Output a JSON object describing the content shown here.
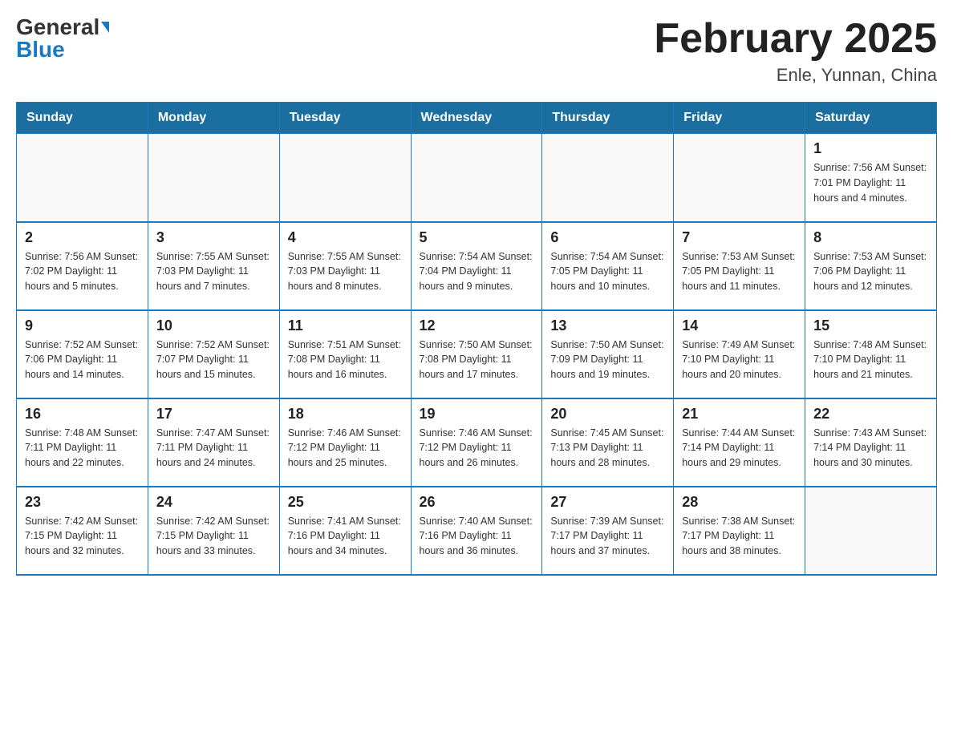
{
  "header": {
    "logo_general": "General",
    "logo_blue": "Blue",
    "month_title": "February 2025",
    "location": "Enle, Yunnan, China"
  },
  "weekdays": [
    "Sunday",
    "Monday",
    "Tuesday",
    "Wednesday",
    "Thursday",
    "Friday",
    "Saturday"
  ],
  "weeks": [
    [
      {
        "day": "",
        "info": ""
      },
      {
        "day": "",
        "info": ""
      },
      {
        "day": "",
        "info": ""
      },
      {
        "day": "",
        "info": ""
      },
      {
        "day": "",
        "info": ""
      },
      {
        "day": "",
        "info": ""
      },
      {
        "day": "1",
        "info": "Sunrise: 7:56 AM\nSunset: 7:01 PM\nDaylight: 11 hours\nand 4 minutes."
      }
    ],
    [
      {
        "day": "2",
        "info": "Sunrise: 7:56 AM\nSunset: 7:02 PM\nDaylight: 11 hours\nand 5 minutes."
      },
      {
        "day": "3",
        "info": "Sunrise: 7:55 AM\nSunset: 7:03 PM\nDaylight: 11 hours\nand 7 minutes."
      },
      {
        "day": "4",
        "info": "Sunrise: 7:55 AM\nSunset: 7:03 PM\nDaylight: 11 hours\nand 8 minutes."
      },
      {
        "day": "5",
        "info": "Sunrise: 7:54 AM\nSunset: 7:04 PM\nDaylight: 11 hours\nand 9 minutes."
      },
      {
        "day": "6",
        "info": "Sunrise: 7:54 AM\nSunset: 7:05 PM\nDaylight: 11 hours\nand 10 minutes."
      },
      {
        "day": "7",
        "info": "Sunrise: 7:53 AM\nSunset: 7:05 PM\nDaylight: 11 hours\nand 11 minutes."
      },
      {
        "day": "8",
        "info": "Sunrise: 7:53 AM\nSunset: 7:06 PM\nDaylight: 11 hours\nand 12 minutes."
      }
    ],
    [
      {
        "day": "9",
        "info": "Sunrise: 7:52 AM\nSunset: 7:06 PM\nDaylight: 11 hours\nand 14 minutes."
      },
      {
        "day": "10",
        "info": "Sunrise: 7:52 AM\nSunset: 7:07 PM\nDaylight: 11 hours\nand 15 minutes."
      },
      {
        "day": "11",
        "info": "Sunrise: 7:51 AM\nSunset: 7:08 PM\nDaylight: 11 hours\nand 16 minutes."
      },
      {
        "day": "12",
        "info": "Sunrise: 7:50 AM\nSunset: 7:08 PM\nDaylight: 11 hours\nand 17 minutes."
      },
      {
        "day": "13",
        "info": "Sunrise: 7:50 AM\nSunset: 7:09 PM\nDaylight: 11 hours\nand 19 minutes."
      },
      {
        "day": "14",
        "info": "Sunrise: 7:49 AM\nSunset: 7:10 PM\nDaylight: 11 hours\nand 20 minutes."
      },
      {
        "day": "15",
        "info": "Sunrise: 7:48 AM\nSunset: 7:10 PM\nDaylight: 11 hours\nand 21 minutes."
      }
    ],
    [
      {
        "day": "16",
        "info": "Sunrise: 7:48 AM\nSunset: 7:11 PM\nDaylight: 11 hours\nand 22 minutes."
      },
      {
        "day": "17",
        "info": "Sunrise: 7:47 AM\nSunset: 7:11 PM\nDaylight: 11 hours\nand 24 minutes."
      },
      {
        "day": "18",
        "info": "Sunrise: 7:46 AM\nSunset: 7:12 PM\nDaylight: 11 hours\nand 25 minutes."
      },
      {
        "day": "19",
        "info": "Sunrise: 7:46 AM\nSunset: 7:12 PM\nDaylight: 11 hours\nand 26 minutes."
      },
      {
        "day": "20",
        "info": "Sunrise: 7:45 AM\nSunset: 7:13 PM\nDaylight: 11 hours\nand 28 minutes."
      },
      {
        "day": "21",
        "info": "Sunrise: 7:44 AM\nSunset: 7:14 PM\nDaylight: 11 hours\nand 29 minutes."
      },
      {
        "day": "22",
        "info": "Sunrise: 7:43 AM\nSunset: 7:14 PM\nDaylight: 11 hours\nand 30 minutes."
      }
    ],
    [
      {
        "day": "23",
        "info": "Sunrise: 7:42 AM\nSunset: 7:15 PM\nDaylight: 11 hours\nand 32 minutes."
      },
      {
        "day": "24",
        "info": "Sunrise: 7:42 AM\nSunset: 7:15 PM\nDaylight: 11 hours\nand 33 minutes."
      },
      {
        "day": "25",
        "info": "Sunrise: 7:41 AM\nSunset: 7:16 PM\nDaylight: 11 hours\nand 34 minutes."
      },
      {
        "day": "26",
        "info": "Sunrise: 7:40 AM\nSunset: 7:16 PM\nDaylight: 11 hours\nand 36 minutes."
      },
      {
        "day": "27",
        "info": "Sunrise: 7:39 AM\nSunset: 7:17 PM\nDaylight: 11 hours\nand 37 minutes."
      },
      {
        "day": "28",
        "info": "Sunrise: 7:38 AM\nSunset: 7:17 PM\nDaylight: 11 hours\nand 38 minutes."
      },
      {
        "day": "",
        "info": ""
      }
    ]
  ]
}
